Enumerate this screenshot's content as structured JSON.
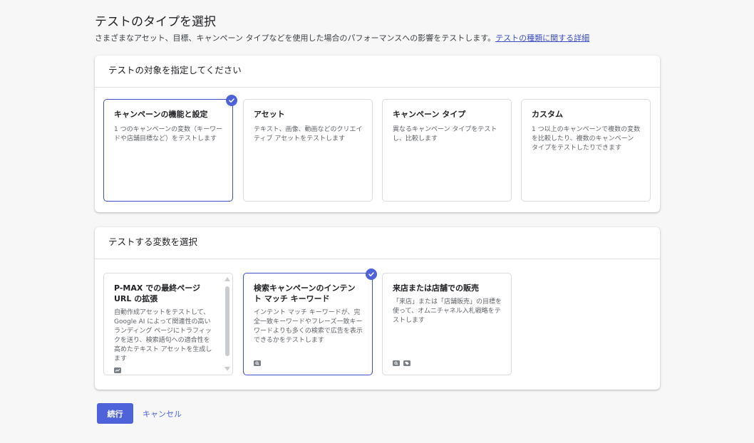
{
  "header": {
    "title": "テストのタイプを選択",
    "subtitle": "さまざまなアセット、目標、キャンペーン タイプなどを使用した場合のパフォーマンスへの影響をテストします。",
    "link": "テストの種類に関する詳細"
  },
  "targetSection": {
    "title": "テストの対象を指定してください",
    "cards": [
      {
        "title": "キャンペーンの機能と設定",
        "desc": "1 つのキャンペーンの変数（キーワードや店舗目標など）をテストします",
        "selected": true
      },
      {
        "title": "アセット",
        "desc": "テキスト、画像、動画などのクリエイティブ アセットをテストします",
        "selected": false
      },
      {
        "title": "キャンペーン タイプ",
        "desc": "異なるキャンペーン タイプをテストし、比較します",
        "selected": false
      },
      {
        "title": "カスタム",
        "desc": "1 つ以上のキャンペーンで複数の変数を比較したり、複数のキャンペーン タイプをテストしたりできます",
        "selected": false
      }
    ]
  },
  "variableSection": {
    "title": "テストする変数を選択",
    "cards": [
      {
        "title": "P-MAX での最終ページ URL の拡張",
        "desc": "自動作成アセットをテストして、Google AI によって関連性の高いランディング ページにトラフィックを送り、検索語句への適合性を高めたテキスト アセットを生成します",
        "icons": [
          "pmax-icon"
        ],
        "selected": false
      },
      {
        "title": "検索キャンペーンのインテント マッチ キーワード",
        "desc": "インテント マッチ キーワードが、完全一致キーワードやフレーズ一致キーワードよりも多くの検索で広告を表示できるかをテストします",
        "icons": [
          "search-icon"
        ],
        "selected": true
      },
      {
        "title": "来店または店舗での販売",
        "desc": "「来店」または「店舗販売」の目標を使って、オムニチャネル入札戦略をテストします",
        "icons": [
          "search-icon",
          "tag-icon"
        ],
        "selected": false
      }
    ]
  },
  "actions": {
    "continue": "続行",
    "cancel": "キャンセル"
  },
  "colors": {
    "accent": "#4e63d9",
    "selectedBorder": "#3f51c8",
    "link": "#3b4ec8"
  }
}
